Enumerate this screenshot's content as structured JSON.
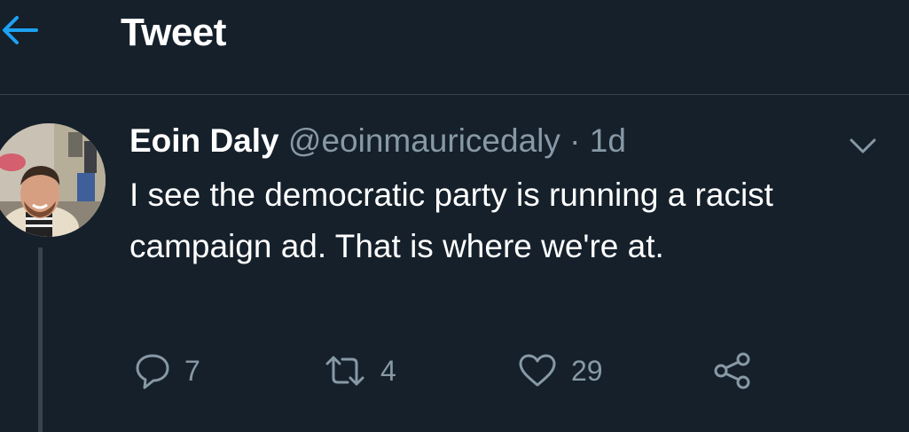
{
  "header": {
    "back_icon": "arrow-left-icon",
    "title": "Tweet"
  },
  "tweet": {
    "author_name": "Eoin Daly",
    "author_handle": "@eoinmauricedaly",
    "separator": "·",
    "time": "1d",
    "text": "I see the democratic party is running a racist campaign ad. That is where we're at.",
    "menu_icon": "chevron-down-icon",
    "actions": {
      "reply": {
        "icon": "reply-icon",
        "count": "7"
      },
      "retweet": {
        "icon": "retweet-icon",
        "count": "4"
      },
      "like": {
        "icon": "heart-icon",
        "count": "29"
      },
      "share": {
        "icon": "share-icon"
      }
    }
  },
  "colors": {
    "background": "#15202b",
    "accent": "#1da1f2",
    "secondary_text": "#8899a6",
    "divider": "#38444d",
    "primary_text": "#ffffff"
  }
}
